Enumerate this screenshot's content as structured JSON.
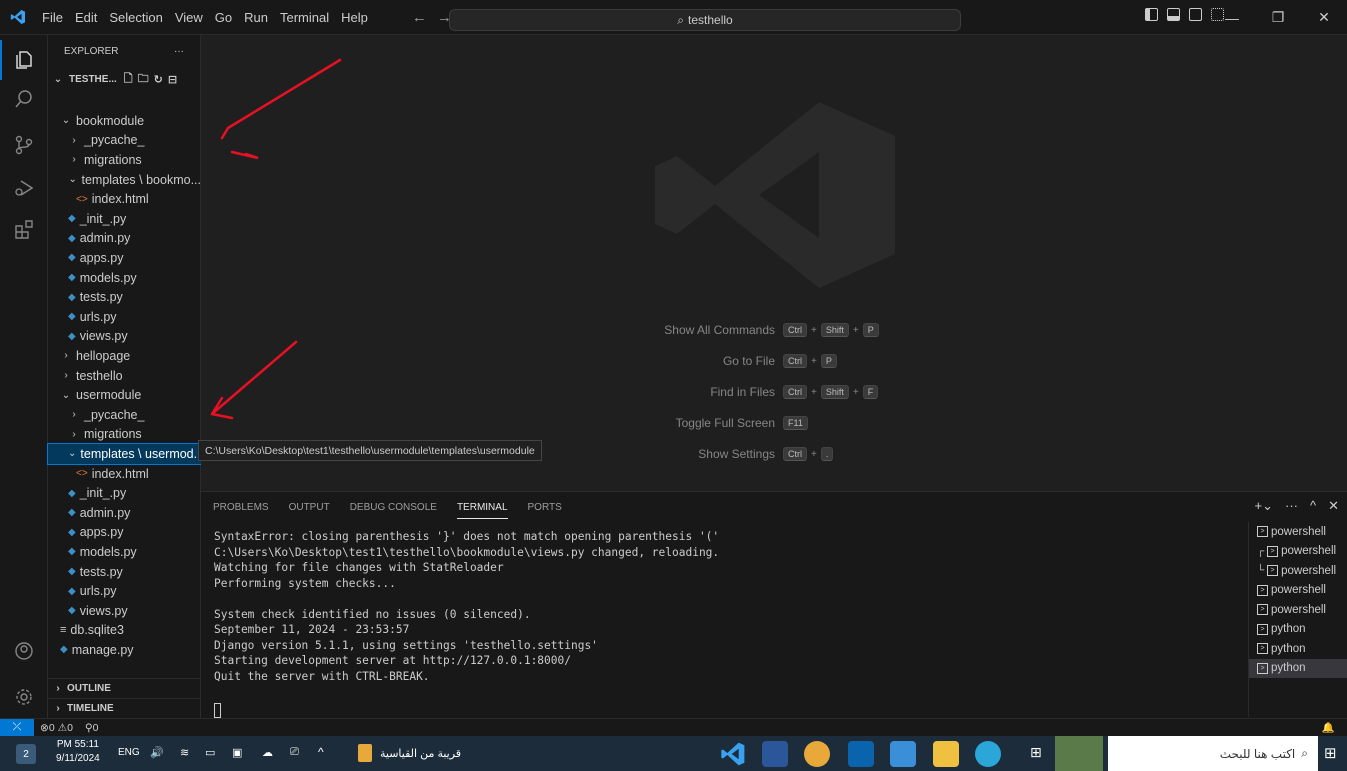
{
  "titlebar": {
    "menu": [
      "File",
      "Edit",
      "Selection",
      "View",
      "Go",
      "Run",
      "Terminal",
      "Help"
    ],
    "search_text": "testhello",
    "nav_back": "←",
    "nav_forward": "→"
  },
  "sidebar": {
    "header": "EXPLORER",
    "more": "···",
    "project": "TESTHE...",
    "tree": [
      {
        "label": "bookmodule",
        "kind": "folder-open",
        "indent": 1
      },
      {
        "label": "_pycache_",
        "kind": "folder",
        "indent": 2
      },
      {
        "label": "migrations",
        "kind": "folder",
        "indent": 2
      },
      {
        "label": "templates \\ bookmo...",
        "kind": "folder-open",
        "indent": 2
      },
      {
        "label": "index.html",
        "kind": "html",
        "indent": 3
      },
      {
        "label": "_init_.py",
        "kind": "py",
        "indent": 2
      },
      {
        "label": "admin.py",
        "kind": "py",
        "indent": 2
      },
      {
        "label": "apps.py",
        "kind": "py",
        "indent": 2
      },
      {
        "label": "models.py",
        "kind": "py",
        "indent": 2
      },
      {
        "label": "tests.py",
        "kind": "py",
        "indent": 2
      },
      {
        "label": "urls.py",
        "kind": "py",
        "indent": 2
      },
      {
        "label": "views.py",
        "kind": "py",
        "indent": 2
      },
      {
        "label": "hellopage",
        "kind": "folder",
        "indent": 1
      },
      {
        "label": "testhello",
        "kind": "folder",
        "indent": 1
      },
      {
        "label": "usermodule",
        "kind": "folder-open",
        "indent": 1
      },
      {
        "label": "_pycache_",
        "kind": "folder",
        "indent": 2
      },
      {
        "label": "migrations",
        "kind": "folder",
        "indent": 2
      },
      {
        "label": "templates \\ usermod...",
        "kind": "folder-open",
        "indent": 2,
        "selected": true
      },
      {
        "label": "index.html",
        "kind": "html",
        "indent": 3
      },
      {
        "label": "_init_.py",
        "kind": "py",
        "indent": 2
      },
      {
        "label": "admin.py",
        "kind": "py",
        "indent": 2
      },
      {
        "label": "apps.py",
        "kind": "py",
        "indent": 2
      },
      {
        "label": "models.py",
        "kind": "py",
        "indent": 2
      },
      {
        "label": "tests.py",
        "kind": "py",
        "indent": 2
      },
      {
        "label": "urls.py",
        "kind": "py",
        "indent": 2
      },
      {
        "label": "views.py",
        "kind": "py",
        "indent": 2
      },
      {
        "label": "db.sqlite3",
        "kind": "db",
        "indent": 1
      },
      {
        "label": "manage.py",
        "kind": "py",
        "indent": 1
      }
    ],
    "outline": "OUTLINE",
    "timeline": "TIMELINE"
  },
  "editor": {
    "hints": [
      {
        "label": "Show All Commands",
        "keys": [
          "Ctrl",
          "Shift",
          "P"
        ]
      },
      {
        "label": "Go to File",
        "keys": [
          "Ctrl",
          "P"
        ]
      },
      {
        "label": "Find in Files",
        "keys": [
          "Ctrl",
          "Shift",
          "F"
        ]
      },
      {
        "label": "Toggle Full Screen",
        "keys": [
          "F11"
        ]
      },
      {
        "label": "Show Settings",
        "keys": [
          "Ctrl",
          "."
        ]
      }
    ],
    "tooltip": "C:\\Users\\Ko\\Desktop\\test1\\testhello\\usermodule\\templates\\usermodule"
  },
  "panel": {
    "tabs": [
      "PROBLEMS",
      "OUTPUT",
      "DEBUG CONSOLE",
      "TERMINAL",
      "PORTS"
    ],
    "active_tab": "TERMINAL",
    "terminal_lines": [
      "SyntaxError: closing parenthesis '}' does not match opening parenthesis '('",
      "C:\\Users\\Ko\\Desktop\\test1\\testhello\\bookmodule\\views.py changed, reloading.",
      "Watching for file changes with StatReloader",
      "Performing system checks...",
      "",
      "System check identified no issues (0 silenced).",
      "September 11, 2024 - 23:53:57",
      "Django version 5.1.1, using settings 'testhello.settings'",
      "Starting development server at http://127.0.0.1:8000/",
      "Quit the server with CTRL-BREAK."
    ],
    "terminals": [
      {
        "label": "powershell",
        "prefix": ""
      },
      {
        "label": "powershell",
        "prefix": "┌"
      },
      {
        "label": "powershell",
        "prefix": "└"
      },
      {
        "label": "powershell",
        "prefix": ""
      },
      {
        "label": "powershell",
        "prefix": ""
      },
      {
        "label": "python",
        "prefix": ""
      },
      {
        "label": "python",
        "prefix": ""
      },
      {
        "label": "python",
        "prefix": "",
        "selected": true
      }
    ]
  },
  "statusbar": {
    "errors": "0",
    "warnings": "0",
    "ports": "0"
  },
  "taskbar": {
    "time": "PM 55:11",
    "date": "9/11/2024",
    "lang": "ENG",
    "weather": "قريبة من القياسية",
    "search": "اكتب هنا للبحث",
    "badge": "2"
  },
  "colors": {
    "accent": "#0078d4",
    "python_icon": "#3c90c8",
    "html_icon": "#e37933",
    "annotation": "#e81123"
  }
}
